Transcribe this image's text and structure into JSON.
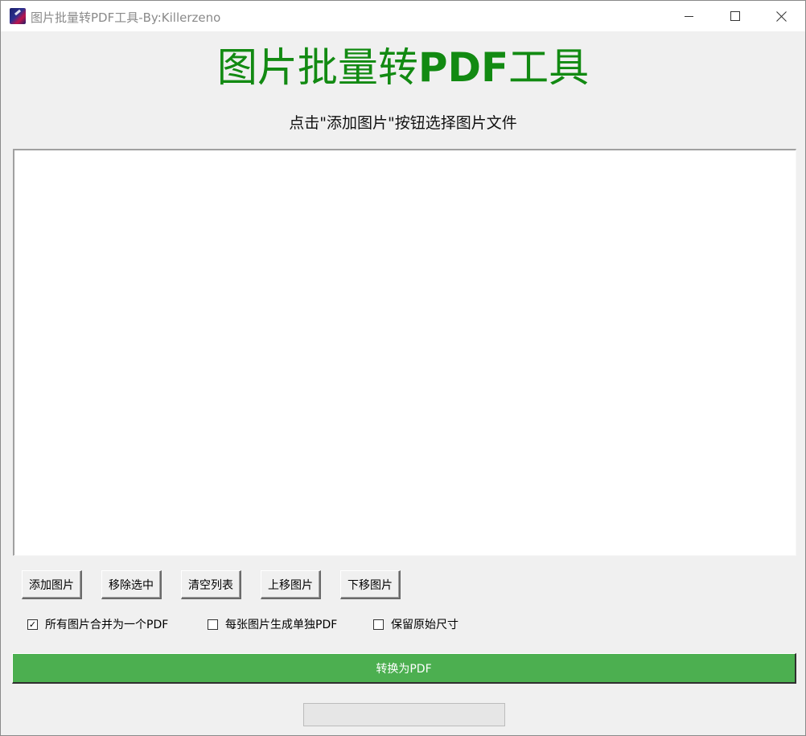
{
  "window": {
    "title": "图片批量转PDF工具-By:Killerzeno"
  },
  "header": {
    "title_part1": "图片批量转",
    "title_part2": "PDF",
    "title_part3": "工具",
    "instruction": "点击\"添加图片\"按钮选择图片文件",
    "title_color": "#128a12"
  },
  "image_list": {
    "items": []
  },
  "toolbar": {
    "add_label": "添加图片",
    "remove_label": "移除选中",
    "clear_label": "清空列表",
    "move_up_label": "上移图片",
    "move_down_label": "下移图片"
  },
  "options": {
    "merge_all": {
      "label": "所有图片合并为一个PDF",
      "checked": true,
      "mark": "✓"
    },
    "separate": {
      "label": "每张图片生成单独PDF",
      "checked": false,
      "mark": ""
    },
    "keep_size": {
      "label": "保留原始尺寸",
      "checked": false,
      "mark": ""
    }
  },
  "convert_button": {
    "label": "转换为PDF",
    "color": "#4caf50"
  },
  "progress": {
    "fraction": 0
  }
}
